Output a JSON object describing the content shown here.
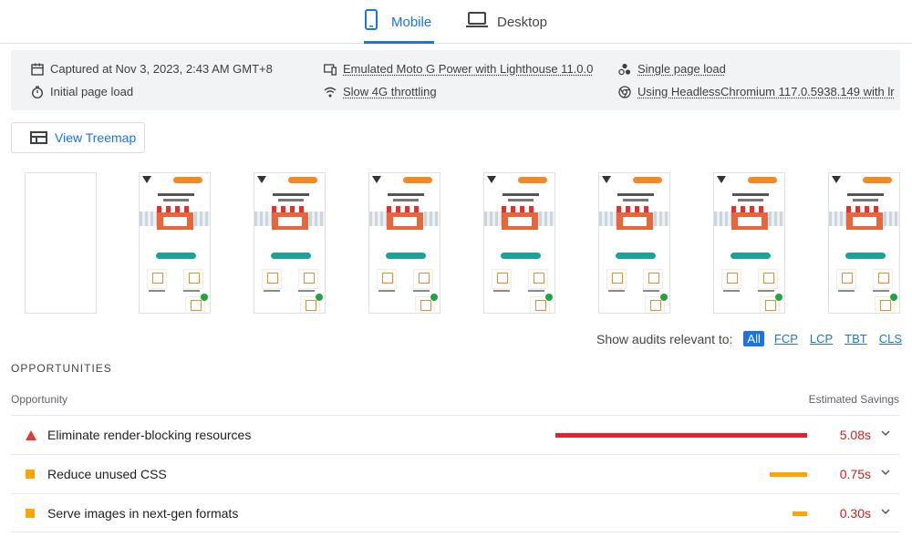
{
  "tabs": [
    {
      "label": "Mobile",
      "active": true,
      "icon": "phone-icon"
    },
    {
      "label": "Desktop",
      "active": false,
      "icon": "laptop-icon"
    }
  ],
  "runtime": {
    "captured": "Captured at Nov 3, 2023, 2:43 AM GMT+8",
    "initial_load": "Initial page load",
    "device": "Emulated Moto G Power with Lighthouse 11.0.0",
    "throttling": "Slow 4G throttling",
    "session": "Single page load",
    "browser": "Using HeadlessChromium 117.0.5938.149 with lr"
  },
  "treemap_button": "View Treemap",
  "filmstrip": {
    "frame_count": 8,
    "blank_frames": 1
  },
  "filter": {
    "label": "Show audits relevant to:",
    "options": [
      "All",
      "FCP",
      "LCP",
      "TBT",
      "CLS"
    ],
    "active": "All"
  },
  "opportunities": {
    "section_title": "OPPORTUNITIES",
    "col_left": "Opportunity",
    "col_right": "Estimated Savings",
    "items": [
      {
        "title": "Eliminate render-blocking resources",
        "savings": "5.08s",
        "severity": "fail",
        "color": "#e8202a",
        "fraction": 1.0
      },
      {
        "title": "Reduce unused CSS",
        "savings": "0.75s",
        "severity": "average",
        "color": "#ffa400",
        "fraction": 0.148
      },
      {
        "title": "Serve images in next-gen formats",
        "savings": "0.30s",
        "severity": "average",
        "color": "#ffa400",
        "fraction": 0.059
      }
    ]
  },
  "colors": {
    "accent": "#1a73e8",
    "fail": "#e53935",
    "average": "#ffa400",
    "savings_text": "#c5221f"
  }
}
